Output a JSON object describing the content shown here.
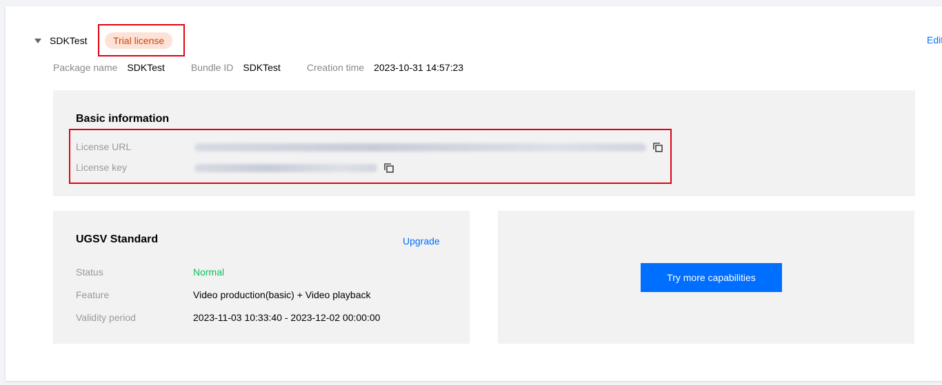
{
  "app": {
    "name": "SDKTest",
    "badge": "Trial license",
    "edit_label": "Edit"
  },
  "meta": {
    "package_label": "Package name",
    "package_value": "SDKTest",
    "bundle_label": "Bundle ID",
    "bundle_value": "SDKTest",
    "created_label": "Creation time",
    "created_value": "2023-10-31 14:57:23"
  },
  "basic": {
    "title": "Basic information",
    "license_url_label": "License URL",
    "license_key_label": "License key"
  },
  "ugsv": {
    "title": "UGSV Standard",
    "upgrade_label": "Upgrade",
    "status_label": "Status",
    "status_value": "Normal",
    "feature_label": "Feature",
    "feature_value": "Video production(basic) + Video playback",
    "validity_label": "Validity period",
    "validity_value": "2023-11-03 10:33:40 - 2023-12-02 00:00:00"
  },
  "more": {
    "button_label": "Try more capabilities"
  },
  "icons": {
    "caret": "caret-down-icon",
    "copy": "copy-icon"
  },
  "colors": {
    "accent": "#006eff",
    "highlight_box": "#e1000f",
    "status_normal": "#0abf5b",
    "badge_bg": "#fde3d7",
    "badge_text": "#d0400d",
    "panel_bg": "#f2f2f2"
  }
}
